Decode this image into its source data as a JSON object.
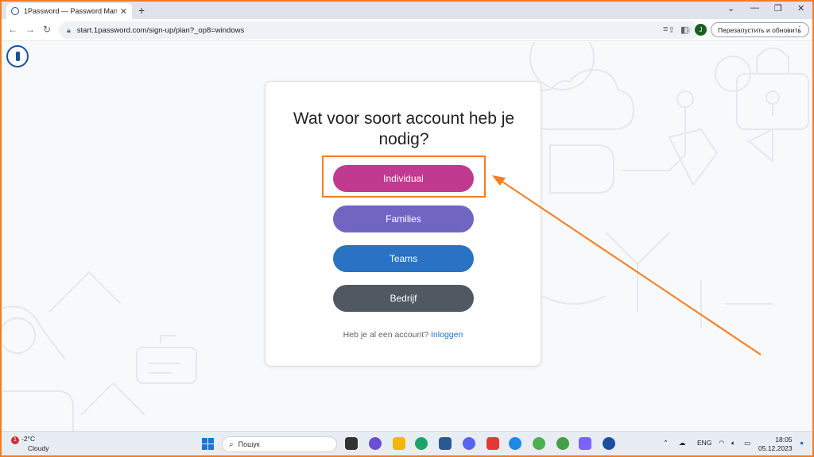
{
  "browser": {
    "tab_title": "1Password — Password Manag...",
    "url": "start.1password.com/sign-up/plan?_op8=windows",
    "profile_initial": "J",
    "restart_label": "Перезапустить и обновить"
  },
  "signup": {
    "heading": "Wat voor soort account heb je nodig?",
    "plans": [
      {
        "label": "Individual",
        "color": "#c03a8f"
      },
      {
        "label": "Families",
        "color": "#7066c2"
      },
      {
        "label": "Teams",
        "color": "#2a72c3"
      },
      {
        "label": "Bedrijf",
        "color": "#505862"
      }
    ],
    "login_prompt": "Heb je al een account?",
    "login_link": "Inloggen"
  },
  "annotation": {
    "color": "#f57c1f"
  },
  "taskbar": {
    "weather_badge": "1",
    "temperature": "-2°C",
    "condition": "Cloudy",
    "search_placeholder": "Пошук",
    "language": "ENG",
    "time": "18:05",
    "date": "05.12.2023"
  }
}
